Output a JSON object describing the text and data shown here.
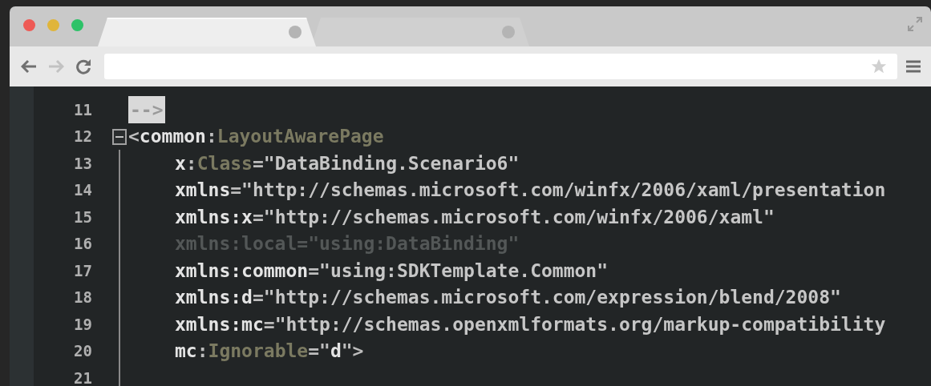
{
  "browser": {
    "tabs": [
      {
        "selected": true
      },
      {
        "selected": false
      }
    ],
    "nav": [
      {
        "kind": "back",
        "disabled": false
      },
      {
        "kind": "forward",
        "disabled": true
      },
      {
        "kind": "reload",
        "disabled": false
      }
    ]
  },
  "editor": {
    "lines": [
      {
        "number": "11",
        "tokens": [
          {
            "text": "-->",
            "kind": "selected"
          }
        ]
      },
      {
        "number": "12",
        "expanded": true,
        "tokens": [
          {
            "text": "<",
            "kind": "punct"
          },
          {
            "text": "common",
            "kind": "attr"
          },
          {
            "text": ":",
            "kind": "punct"
          },
          {
            "text": "LayoutAwarePage",
            "kind": "type"
          }
        ],
        "children": [
          {
            "number": "13",
            "tokens": [
              {
                "text": "x",
                "kind": "attr"
              },
              {
                "text": ":",
                "kind": "punct"
              },
              {
                "text": "Class",
                "kind": "type"
              },
              {
                "text": "=",
                "kind": "punct"
              },
              {
                "text": "\"DataBinding.Scenario6\"",
                "kind": "value"
              }
            ]
          },
          {
            "number": "14",
            "tokens": [
              {
                "text": "xmlns",
                "kind": "attr"
              },
              {
                "text": "=",
                "kind": "punct"
              },
              {
                "text": "\"http://schemas.microsoft.com/winfx/2006/xaml/presentation",
                "kind": "value"
              }
            ]
          },
          {
            "number": "15",
            "tokens": [
              {
                "text": "xmlns:x",
                "kind": "attr"
              },
              {
                "text": "=",
                "kind": "punct"
              },
              {
                "text": "\"http://schemas.microsoft.com/winfx/2006/xaml\"",
                "kind": "value"
              }
            ]
          },
          {
            "number": "16",
            "tokens": [
              {
                "text": "xmlns:local=\"using:DataBinding\"",
                "kind": "dim"
              }
            ]
          },
          {
            "number": "17",
            "tokens": [
              {
                "text": "xmlns:common",
                "kind": "attr"
              },
              {
                "text": "=",
                "kind": "punct"
              },
              {
                "text": "\"using:SDKTemplate.Common\"",
                "kind": "value"
              }
            ]
          },
          {
            "number": "18",
            "tokens": [
              {
                "text": "xmlns:d",
                "kind": "attr"
              },
              {
                "text": "=",
                "kind": "punct"
              },
              {
                "text": "\"http://schemas.microsoft.com/expression/blend/2008\"",
                "kind": "value"
              }
            ]
          },
          {
            "number": "19",
            "tokens": [
              {
                "text": "xmlns:mc",
                "kind": "attr"
              },
              {
                "text": "=",
                "kind": "punct"
              },
              {
                "text": "\"http://schemas.openxmlformats.org/markup-compatibility",
                "kind": "value"
              }
            ]
          },
          {
            "number": "20",
            "tokens": [
              {
                "text": "mc",
                "kind": "attr"
              },
              {
                "text": ":",
                "kind": "punct"
              },
              {
                "text": "Ignorable",
                "kind": "type"
              },
              {
                "text": "=\"",
                "kind": "punct"
              },
              {
                "text": "d",
                "kind": "attr"
              },
              {
                "text": "\">",
                "kind": "punct"
              }
            ]
          },
          {
            "number": "21"
          }
        ]
      }
    ]
  }
}
